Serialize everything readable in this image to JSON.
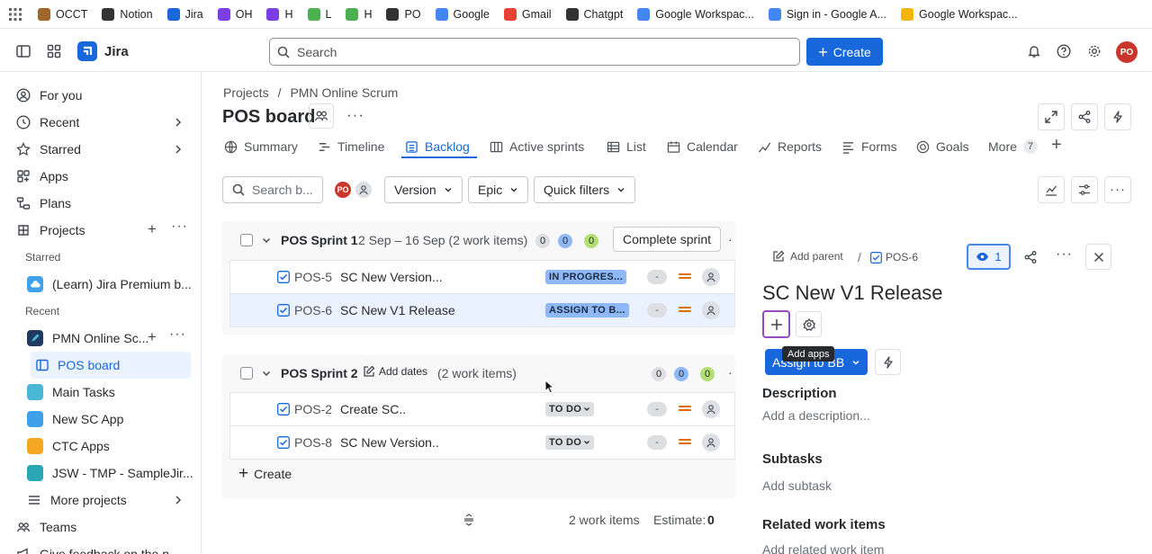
{
  "bookmarks": [
    {
      "label": "OCCT",
      "color": "#a0662b"
    },
    {
      "label": "Notion",
      "color": "#333333"
    },
    {
      "label": "Jira",
      "color": "#1868db"
    },
    {
      "label": "OH",
      "color": "#7b3fe4"
    },
    {
      "label": "H",
      "color": "#7b3fe4"
    },
    {
      "label": "L",
      "color": "#4caf50"
    },
    {
      "label": "H",
      "color": "#4caf50"
    },
    {
      "label": "PO",
      "color": "#333333"
    },
    {
      "label": "Google",
      "color": "#4285f4"
    },
    {
      "label": "Gmail",
      "color": "#ea4335"
    },
    {
      "label": "Chatgpt",
      "color": "#333333"
    },
    {
      "label": "Google Workspac...",
      "color": "#4285f4"
    },
    {
      "label": "Sign in - Google A...",
      "color": "#4285f4"
    },
    {
      "label": "Google Workspac...",
      "color": "#f4b400"
    }
  ],
  "topnav": {
    "app_name": "Jira",
    "search_placeholder": "Search",
    "create_label": "Create",
    "avatar": "PO"
  },
  "sidebar": {
    "items": [
      {
        "label": "For you",
        "icon": "user-circle-icon"
      },
      {
        "label": "Recent",
        "icon": "clock-icon"
      },
      {
        "label": "Starred",
        "icon": "star-icon"
      },
      {
        "label": "Apps",
        "icon": "apps-icon"
      },
      {
        "label": "Plans",
        "icon": "plans-icon"
      },
      {
        "label": "Projects",
        "icon": "projects-icon"
      }
    ],
    "starred_heading": "Starred",
    "starred_item": "(Learn) Jira Premium b...",
    "recent_heading": "Recent",
    "recent_project": "PMN Online Sc...",
    "board": "POS board",
    "projects": [
      {
        "label": "Main Tasks",
        "color": "#4bb7d6"
      },
      {
        "label": "New SC App",
        "color": "#3fa2e8"
      },
      {
        "label": "CTC Apps",
        "color": "#f5a623"
      },
      {
        "label": "JSW - TMP - SampleJir...",
        "color": "#2aa6b5"
      }
    ],
    "more_projects": "More projects",
    "teams": "Teams",
    "feedback": "Give feedback on the n..."
  },
  "header": {
    "breadcrumb_projects": "Projects",
    "breadcrumb_sep": "/",
    "breadcrumb_project": "PMN Online Scrum",
    "title": "POS board"
  },
  "tabs": [
    {
      "label": "Summary",
      "icon": "globe-icon"
    },
    {
      "label": "Timeline",
      "icon": "timeline-icon"
    },
    {
      "label": "Backlog",
      "icon": "backlog-icon"
    },
    {
      "label": "Active sprints",
      "icon": "columns-icon"
    },
    {
      "label": "List",
      "icon": "list-icon"
    },
    {
      "label": "Calendar",
      "icon": "calendar-icon"
    },
    {
      "label": "Reports",
      "icon": "chart-icon"
    },
    {
      "label": "Forms",
      "icon": "forms-icon"
    },
    {
      "label": "Goals",
      "icon": "target-icon"
    },
    {
      "label": "More",
      "icon": ""
    }
  ],
  "more_count": "7",
  "filters": {
    "search_placeholder": "Search b...",
    "avatar": "PO",
    "version": "Version",
    "epic": "Epic",
    "quick_filters": "Quick filters"
  },
  "sprint1": {
    "name": "POS Sprint 1",
    "dates": "2 Sep – 16 Sep (2 work items)",
    "counts": [
      "0",
      "0",
      "0"
    ],
    "complete_label": "Complete sprint",
    "issues": [
      {
        "key": "POS-5",
        "summary": "SC New Version...",
        "status": "IN PROGRES...",
        "estimate": "-"
      },
      {
        "key": "POS-6",
        "summary": "SC New V1 Release",
        "status": "ASSIGN TO B...",
        "estimate": "-"
      }
    ]
  },
  "sprint2": {
    "name": "POS Sprint 2",
    "add_dates": "Add dates",
    "count_text": "(2 work items)",
    "counts": [
      "0",
      "0",
      "0"
    ],
    "issues": [
      {
        "key": "POS-2",
        "summary": "Create SC..",
        "status": "TO DO",
        "estimate": "-"
      },
      {
        "key": "POS-8",
        "summary": "SC New Version..",
        "status": "TO DO",
        "estimate": "-"
      }
    ],
    "create_label": "Create",
    "footer_items": "2 work items",
    "footer_estimate_label": "Estimate:",
    "footer_estimate_value": "0"
  },
  "panel": {
    "add_parent": "Add parent",
    "sep": "/",
    "issue_key": "POS-6",
    "watchers": "1",
    "title": "SC New V1 Release",
    "tooltip": "Add apps",
    "status_button": "Assign to BB",
    "description_heading": "Description",
    "description_placeholder": "Add a description...",
    "subtasks_heading": "Subtasks",
    "subtasks_placeholder": "Add subtask",
    "related_heading": "Related work items",
    "related_placeholder": "Add related work item"
  }
}
